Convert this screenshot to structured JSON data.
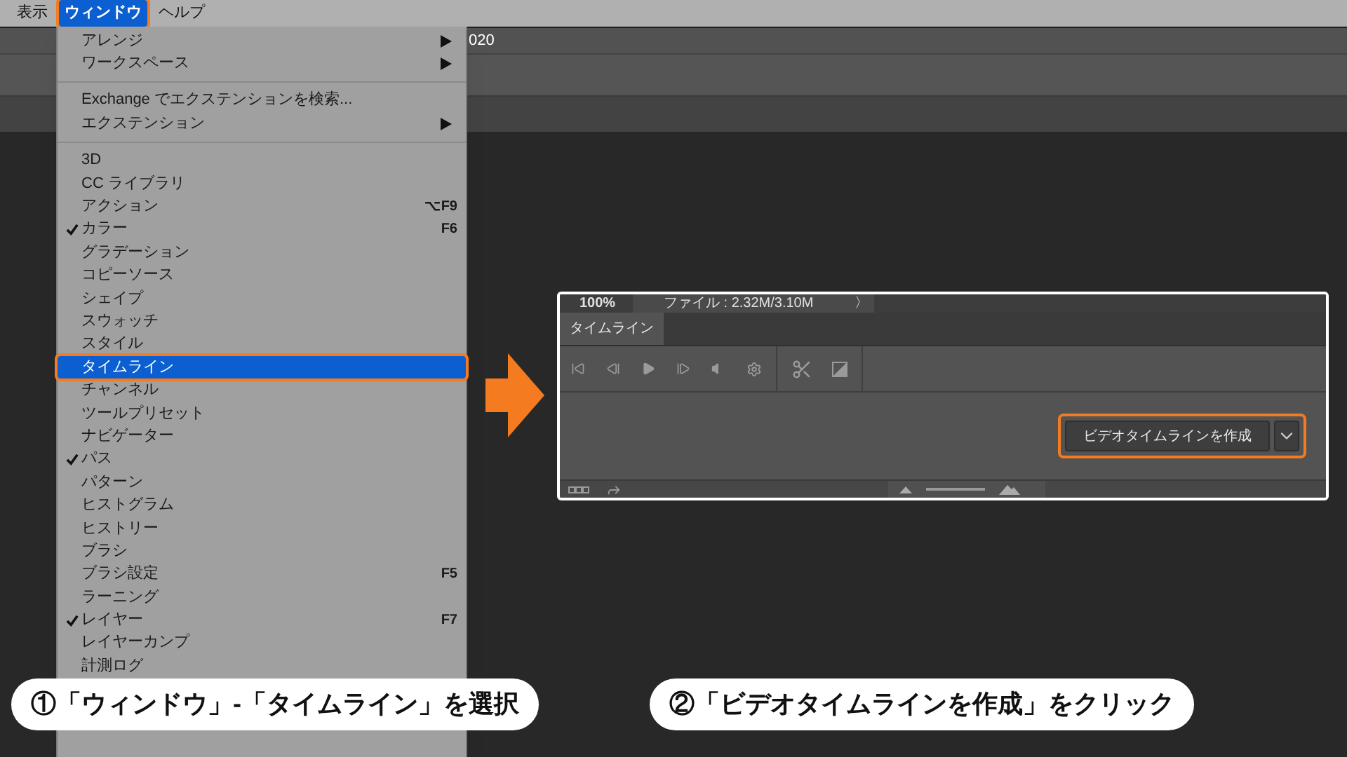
{
  "menubar": {
    "items": [
      {
        "label": "表示",
        "selected": false,
        "highlighted": false
      },
      {
        "label": "ウィンドウ",
        "selected": true,
        "highlighted": true
      },
      {
        "label": "ヘルプ",
        "selected": false,
        "highlighted": false
      }
    ]
  },
  "document_title": "020",
  "window_menu": {
    "items": [
      {
        "kind": "item",
        "label": "アレンジ",
        "submenu": true,
        "checked": false,
        "selected": false,
        "highlighted": false
      },
      {
        "kind": "item",
        "label": "ワークスペース",
        "submenu": true,
        "checked": false,
        "selected": false,
        "highlighted": false
      },
      {
        "kind": "separator"
      },
      {
        "kind": "item",
        "label": "Exchange でエクステンションを検索...",
        "submenu": false,
        "checked": false,
        "selected": false,
        "highlighted": false
      },
      {
        "kind": "item",
        "label": "エクステンション",
        "submenu": true,
        "checked": false,
        "selected": false,
        "highlighted": false
      },
      {
        "kind": "separator"
      },
      {
        "kind": "item",
        "label": "3D",
        "submenu": false,
        "checked": false,
        "selected": false,
        "highlighted": false
      },
      {
        "kind": "item",
        "label": "CC ライブラリ",
        "submenu": false,
        "checked": false,
        "selected": false,
        "highlighted": false
      },
      {
        "kind": "item",
        "label": "アクション",
        "shortcut": "⌥F9",
        "submenu": false,
        "checked": false,
        "selected": false,
        "highlighted": false
      },
      {
        "kind": "item",
        "label": "カラー",
        "shortcut": "F6",
        "submenu": false,
        "checked": true,
        "selected": false,
        "highlighted": false
      },
      {
        "kind": "item",
        "label": "グラデーション",
        "submenu": false,
        "checked": false,
        "selected": false,
        "highlighted": false
      },
      {
        "kind": "item",
        "label": "コピーソース",
        "submenu": false,
        "checked": false,
        "selected": false,
        "highlighted": false
      },
      {
        "kind": "item",
        "label": "シェイプ",
        "submenu": false,
        "checked": false,
        "selected": false,
        "highlighted": false
      },
      {
        "kind": "item",
        "label": "スウォッチ",
        "submenu": false,
        "checked": false,
        "selected": false,
        "highlighted": false
      },
      {
        "kind": "item",
        "label": "スタイル",
        "submenu": false,
        "checked": false,
        "selected": false,
        "highlighted": false
      },
      {
        "kind": "item",
        "label": "タイムライン",
        "submenu": false,
        "checked": false,
        "selected": true,
        "highlighted": true
      },
      {
        "kind": "item",
        "label": "チャンネル",
        "submenu": false,
        "checked": false,
        "selected": false,
        "highlighted": false
      },
      {
        "kind": "item",
        "label": "ツールプリセット",
        "submenu": false,
        "checked": false,
        "selected": false,
        "highlighted": false
      },
      {
        "kind": "item",
        "label": "ナビゲーター",
        "submenu": false,
        "checked": false,
        "selected": false,
        "highlighted": false
      },
      {
        "kind": "item",
        "label": "パス",
        "submenu": false,
        "checked": true,
        "selected": false,
        "highlighted": false
      },
      {
        "kind": "item",
        "label": "パターン",
        "submenu": false,
        "checked": false,
        "selected": false,
        "highlighted": false
      },
      {
        "kind": "item",
        "label": "ヒストグラム",
        "submenu": false,
        "checked": false,
        "selected": false,
        "highlighted": false
      },
      {
        "kind": "item",
        "label": "ヒストリー",
        "submenu": false,
        "checked": false,
        "selected": false,
        "highlighted": false
      },
      {
        "kind": "item",
        "label": "ブラシ",
        "submenu": false,
        "checked": false,
        "selected": false,
        "highlighted": false
      },
      {
        "kind": "item",
        "label": "ブラシ設定",
        "shortcut": "F5",
        "submenu": false,
        "checked": false,
        "selected": false,
        "highlighted": false
      },
      {
        "kind": "item",
        "label": "ラーニング",
        "submenu": false,
        "checked": false,
        "selected": false,
        "highlighted": false
      },
      {
        "kind": "item",
        "label": "レイヤー",
        "shortcut": "F7",
        "submenu": false,
        "checked": true,
        "selected": false,
        "highlighted": false
      },
      {
        "kind": "item",
        "label": "レイヤーカンプ",
        "submenu": false,
        "checked": false,
        "selected": false,
        "highlighted": false
      },
      {
        "kind": "item",
        "label": "計測ログ",
        "submenu": false,
        "checked": false,
        "selected": false,
        "highlighted": false
      }
    ]
  },
  "timeline_panel": {
    "zoom": "100%",
    "file_info": "ファイル : 2.32M/3.10M",
    "more": "〉",
    "tab": {
      "label": "タイムライン",
      "selected": true
    },
    "create_button": {
      "label": "ビデオタイムラインを作成",
      "highlighted": true
    }
  },
  "captions": [
    {
      "label": "①「ウィンドウ」-「タイムライン」を選択"
    },
    {
      "label": "②「ビデオタイムラインを作成」をクリック"
    }
  ]
}
